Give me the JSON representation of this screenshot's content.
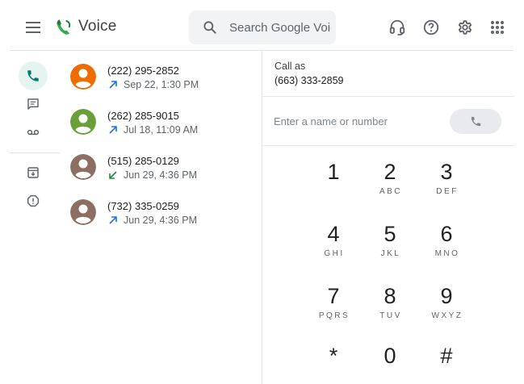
{
  "header": {
    "title": "Voice",
    "search_placeholder": "Search Google Voice",
    "icons": [
      "menu-icon",
      "voice-logo",
      "search-icon",
      "headset-icon",
      "help-icon",
      "settings-icon",
      "apps-grid-icon"
    ]
  },
  "rail": {
    "items": [
      {
        "name": "calls",
        "icon": "phone-icon",
        "active": true
      },
      {
        "name": "messages",
        "icon": "message-icon",
        "active": false
      },
      {
        "name": "voicemail",
        "icon": "voicemail-icon",
        "active": false
      },
      {
        "name": "archive",
        "icon": "archive-icon",
        "active": false
      },
      {
        "name": "spam",
        "icon": "spam-icon",
        "active": false
      }
    ]
  },
  "calls": [
    {
      "number": "(222) 295-2852",
      "date": "Sep 22, 1:30 PM",
      "direction": "outgoing",
      "avatar_color": "#ef6c00"
    },
    {
      "number": "(262) 285-9015",
      "date": "Jul 18, 11:09 AM",
      "direction": "outgoing",
      "avatar_color": "#689f38"
    },
    {
      "number": "(515) 285-0129",
      "date": "Jun 29, 4:36 PM",
      "direction": "incoming",
      "avatar_color": "#8d6e63"
    },
    {
      "number": "(732) 335-0259",
      "date": "Jun 29, 4:36 PM",
      "direction": "outgoing",
      "avatar_color": "#8d6e63"
    }
  ],
  "dialer": {
    "call_as_label": "Call as",
    "call_as_number": "(663) 333-2859",
    "input_placeholder": "Enter a name or number",
    "keys": [
      {
        "digit": "1",
        "letters": ""
      },
      {
        "digit": "2",
        "letters": "ABC"
      },
      {
        "digit": "3",
        "letters": "DEF"
      },
      {
        "digit": "4",
        "letters": "GHI"
      },
      {
        "digit": "5",
        "letters": "JKL"
      },
      {
        "digit": "6",
        "letters": "MNO"
      },
      {
        "digit": "7",
        "letters": "PQRS"
      },
      {
        "digit": "8",
        "letters": "TUV"
      },
      {
        "digit": "9",
        "letters": "WXYZ"
      },
      {
        "digit": "*",
        "letters": ""
      },
      {
        "digit": "0",
        "letters": ""
      },
      {
        "digit": "#",
        "letters": ""
      }
    ]
  },
  "colors": {
    "accent": "#00796b",
    "outgoing_arrow": "#1a73e8",
    "incoming_arrow": "#1e8e3e",
    "active_rail_bg": "#e6f4f1"
  }
}
